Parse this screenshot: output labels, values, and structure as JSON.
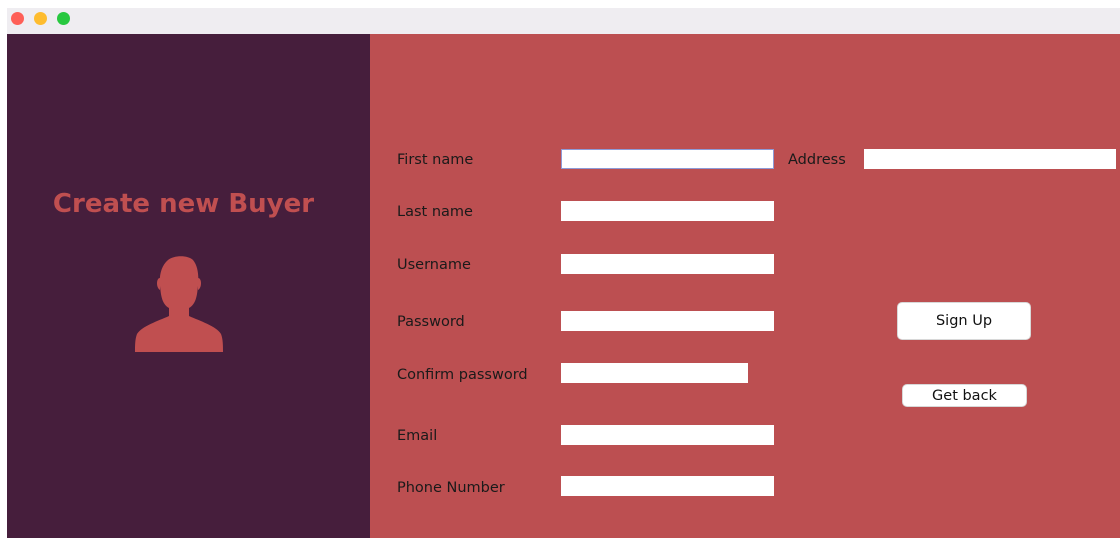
{
  "window": {
    "controls": [
      "close-button",
      "minimize-button",
      "zoom-button"
    ]
  },
  "left_panel": {
    "title": "Create new Buyer",
    "icon": "user-silhouette-icon",
    "colors": {
      "background": "#461e3c",
      "accent": "#c04f50"
    }
  },
  "form": {
    "background": "#bc4f51",
    "fields": {
      "first_name": {
        "label": "First name",
        "value": ""
      },
      "last_name": {
        "label": "Last name",
        "value": ""
      },
      "username": {
        "label": "Username",
        "value": ""
      },
      "password": {
        "label": "Password",
        "value": ""
      },
      "confirm_password": {
        "label": "Confirm password",
        "value": ""
      },
      "email": {
        "label": "Email",
        "value": ""
      },
      "phone_number": {
        "label": "Phone Number",
        "value": ""
      },
      "address": {
        "label": "Address",
        "value": ""
      }
    }
  },
  "buttons": {
    "sign_up": "Sign Up",
    "get_back": "Get back"
  }
}
